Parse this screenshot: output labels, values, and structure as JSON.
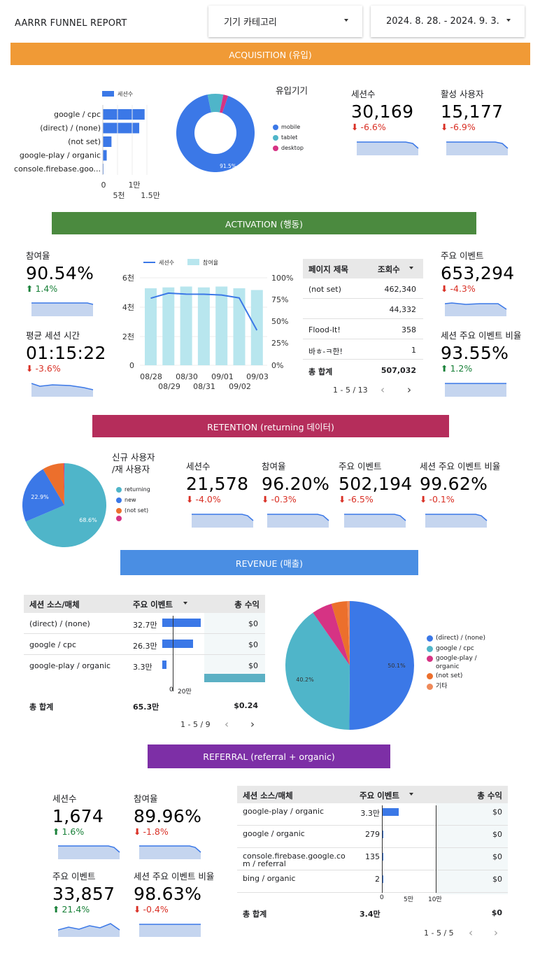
{
  "header": {
    "title": "AARRR FUNNEL REPORT",
    "device_filter": "기기 카테고리",
    "date_range": "2024. 8. 28. - 2024. 9. 3."
  },
  "colors": {
    "acquisition": "#f09a36",
    "activation": "#4b8a3f",
    "retention": "#b52d5b",
    "revenue": "#4a8ee3",
    "referral": "#7d2fa6",
    "bar": "#3b78e7",
    "teal": "#4fb5c9",
    "negative": "#d93025",
    "positive": "#188038"
  },
  "acquisition": {
    "banner": "ACQUISITION (유입)",
    "bar_chart": {
      "legend": "세션수",
      "categories": [
        "google / cpc",
        "(direct) / (none)",
        "(not set)",
        "google-play / organic",
        "console.firebase.goo..."
      ],
      "ticks": [
        "0",
        "1만",
        "5천",
        "1.5만"
      ]
    },
    "donut": {
      "title": "유입기기",
      "legend": [
        "mobile",
        "tablet",
        "desktop"
      ],
      "center_label": "91.5%"
    },
    "kpis": [
      {
        "label": "세션수",
        "value": "30,169",
        "delta": "-6.6%"
      },
      {
        "label": "활성 사용자",
        "value": "15,177",
        "delta": "-6.9%"
      }
    ]
  },
  "activation": {
    "banner": "ACTIVATION (행동)",
    "kpis_left": [
      {
        "label": "참여율",
        "value": "90.54%",
        "delta": "1.4%"
      },
      {
        "label": "평균 세션 시간",
        "value": "01:15:22",
        "delta": "-3.6%"
      }
    ],
    "combo": {
      "legend_line": "세션수",
      "legend_bar": "참여율",
      "left_ticks": [
        "6천",
        "4천",
        "2천",
        "0"
      ],
      "right_ticks": [
        "100%",
        "75%",
        "50%",
        "25%",
        "0%"
      ],
      "x_top": [
        "08/28",
        "08/30",
        "09/01",
        "09/03"
      ],
      "x_bottom": [
        "08/29",
        "08/31",
        "09/02"
      ]
    },
    "table": {
      "col1": "페이지 제목",
      "col2": "조회수",
      "rows": [
        {
          "title": "(not set)",
          "views": "462,340"
        },
        {
          "title": "",
          "views": "44,332"
        },
        {
          "title": "Flood-It!",
          "views": "358"
        },
        {
          "title": "바ㅎ-ㅋ한!",
          "views": "1"
        }
      ],
      "total_label": "총 합계",
      "total_value": "507,032",
      "pager": "1 - 5 / 13"
    },
    "kpis_right": [
      {
        "label": "주요 이벤트",
        "value": "653,294",
        "delta": "-4.3%"
      },
      {
        "label": "세션 주요 이벤트 비율",
        "value": "93.55%",
        "delta": "1.2%"
      }
    ]
  },
  "retention": {
    "banner": "RETENTION (returning 데이터)",
    "pie": {
      "title_line1": "신규 사용자",
      "title_line2": "/재 사용자",
      "legend": [
        "returning",
        "new",
        "(not set)",
        ""
      ],
      "label_big": "68.6%",
      "label_mid": "22.9%"
    },
    "kpis": [
      {
        "label": "세션수",
        "value": "21,578",
        "delta": "-4.0%"
      },
      {
        "label": "참여율",
        "value": "96.20%",
        "delta": "-0.3%"
      },
      {
        "label": "주요 이벤트",
        "value": "502,194",
        "delta": "-6.5%"
      },
      {
        "label": "세션 주요 이벤트 비율",
        "value": "99.62%",
        "delta": "-0.1%"
      }
    ]
  },
  "revenue": {
    "banner": "REVENUE (매출)",
    "table": {
      "col1": "세션 소스/매체",
      "col2": "주요 이벤트",
      "col3": "총 수익",
      "rows": [
        {
          "source": "(direct) / (none)",
          "events": "32.7만",
          "revenue": "$0",
          "bar": 0.55
        },
        {
          "source": "google / cpc",
          "events": "26.3만",
          "revenue": "$0",
          "bar": 0.44
        },
        {
          "source": "google-play / organic",
          "events": "3.3만",
          "revenue": "$0",
          "bar": 0.06
        }
      ],
      "axis": [
        "0",
        "20만"
      ],
      "total_label": "총 합계",
      "total_events": "65.3만",
      "total_revenue": "$0.24",
      "pager": "1 - 5 / 9"
    },
    "pie": {
      "legend": [
        "(direct) / (none)",
        "google / cpc",
        "google-play /",
        "organic",
        "(not set)",
        "기타"
      ],
      "label_big": "50.1%",
      "label_mid": "40.2%"
    }
  },
  "referral": {
    "banner": "REFERRAL (referral + organic)",
    "kpis": [
      {
        "label": "세션수",
        "value": "1,674",
        "delta": "1.6%"
      },
      {
        "label": "참여율",
        "value": "89.96%",
        "delta": "-1.8%"
      },
      {
        "label": "주요 이벤트",
        "value": "33,857",
        "delta": "21.4%"
      },
      {
        "label": "세션 주요 이벤트 비율",
        "value": "98.63%",
        "delta": "-0.4%"
      }
    ],
    "table": {
      "col1": "세션 소스/매체",
      "col2": "주요 이벤트",
      "col3": "총 수익",
      "rows": [
        {
          "source1": "google-play / organic",
          "source2": "",
          "events": "3.3만",
          "revenue": "$0",
          "bar": 0.24
        },
        {
          "source1": "google / organic",
          "source2": "",
          "events": "279",
          "revenue": "$0",
          "bar": 0.02
        },
        {
          "source1": "console.firebase.google.co",
          "source2": "m / referral",
          "events": "135",
          "revenue": "$0",
          "bar": 0.01
        },
        {
          "source1": "bing / organic",
          "source2": "",
          "events": "2",
          "revenue": "$0",
          "bar": 0.005
        }
      ],
      "axis": [
        "0",
        "5만",
        "10만"
      ],
      "total_label": "총 합계",
      "total_events": "3.4만",
      "total_revenue": "$0",
      "pager": "1 - 5 / 5"
    }
  },
  "chart_data": [
    {
      "type": "bar",
      "legend": [
        "세션수"
      ],
      "categories": [
        "google / cpc",
        "(direct) / (none)",
        "(not set)",
        "google-play / organic",
        "console.firebase.goo..."
      ],
      "series": [
        {
          "name": "세션수",
          "values": [
            14000,
            12200,
            2900,
            1300,
            120
          ]
        }
      ],
      "xlim": [
        0,
        15000
      ]
    },
    {
      "type": "pie",
      "title": "유입기기",
      "categories": [
        "mobile",
        "tablet",
        "desktop"
      ],
      "values": [
        91.5,
        6.5,
        2.0
      ]
    },
    {
      "type": "bar",
      "legend": [
        "세션수",
        "참여율"
      ],
      "categories": [
        "08/28",
        "08/29",
        "08/30",
        "08/31",
        "09/01",
        "09/02",
        "09/03"
      ],
      "series": [
        {
          "name": "세션수",
          "type": "line",
          "values": [
            4600,
            4950,
            4880,
            4870,
            4820,
            4620,
            2400
          ]
        },
        {
          "name": "참여율",
          "type": "bar",
          "values": [
            88,
            89,
            90,
            89,
            90,
            88,
            86
          ]
        }
      ],
      "ylim_left": [
        0,
        6000
      ],
      "ylim_right": [
        0,
        100
      ]
    },
    {
      "type": "pie",
      "title": "신규 사용자 /재 사용자",
      "categories": [
        "returning",
        "new",
        "(not set)",
        ""
      ],
      "values": [
        68.6,
        22.9,
        8.2,
        0.3
      ]
    },
    {
      "type": "pie",
      "categories": [
        "(direct) / (none)",
        "google / cpc",
        "google-play / organic",
        "(not set)",
        "기타"
      ],
      "values": [
        50.1,
        40.2,
        5.1,
        4.0,
        0.6
      ]
    }
  ]
}
